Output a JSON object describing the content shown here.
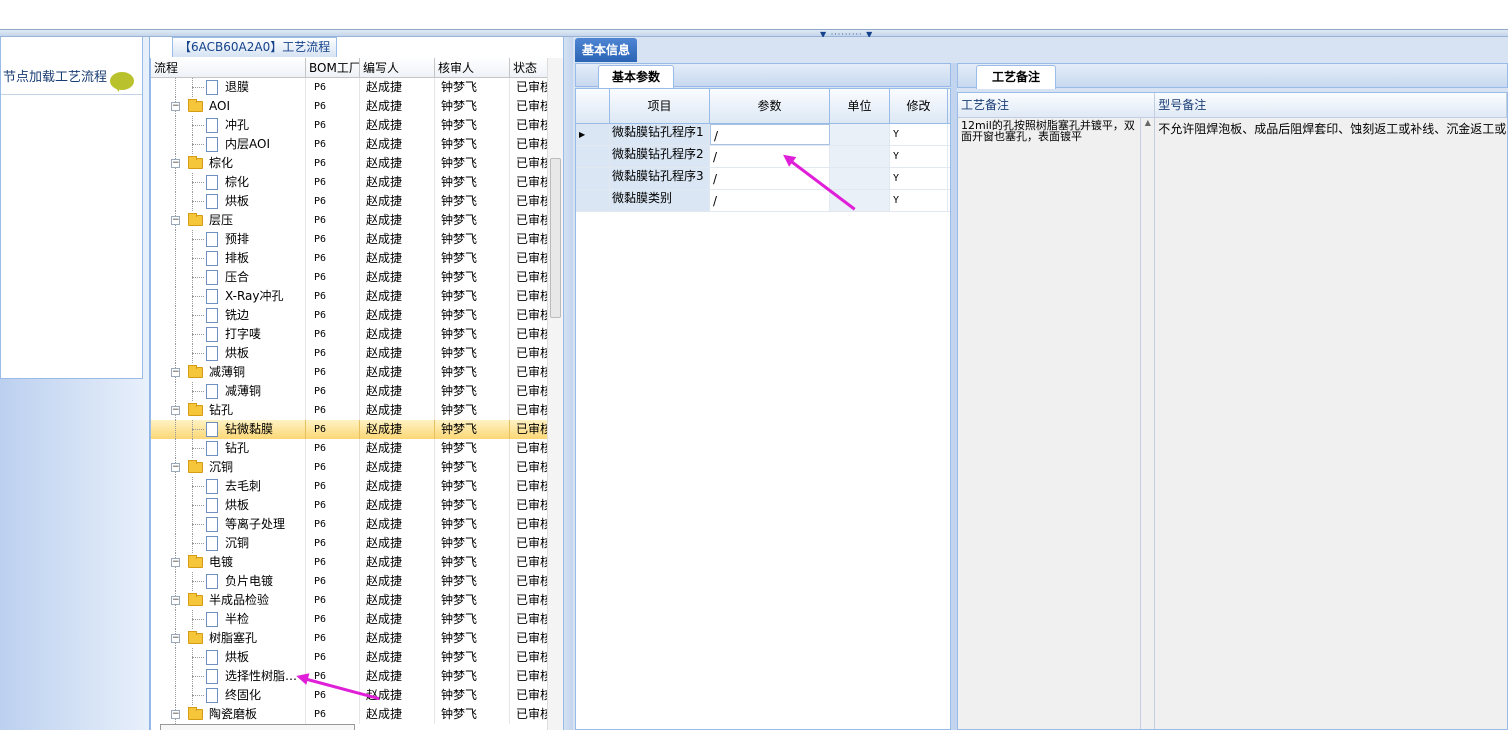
{
  "left_panel": {
    "header": "节点加载工艺流程",
    "bubble_icon": "speech-bubble-icon"
  },
  "tree_tab": {
    "title": "【6ACB60A2A0】工艺流程"
  },
  "tree": {
    "columns": [
      "流程",
      "BOM工厂",
      "编写人",
      "核审人",
      "状态"
    ],
    "rows": [
      {
        "name": "退膜",
        "type": "leaf",
        "bom": "P6",
        "writer": "赵成捷",
        "reviewer": "钟梦飞",
        "status": "已审核"
      },
      {
        "name": "AOI",
        "type": "folder",
        "bom": "P6",
        "writer": "赵成捷",
        "reviewer": "钟梦飞",
        "status": "已审核"
      },
      {
        "name": "冲孔",
        "type": "leaf",
        "bom": "P6",
        "writer": "赵成捷",
        "reviewer": "钟梦飞",
        "status": "已审核"
      },
      {
        "name": "内层AOI",
        "type": "leaf",
        "bom": "P6",
        "writer": "赵成捷",
        "reviewer": "钟梦飞",
        "status": "已审核"
      },
      {
        "name": "棕化",
        "type": "folder",
        "bom": "P6",
        "writer": "赵成捷",
        "reviewer": "钟梦飞",
        "status": "已审核"
      },
      {
        "name": "棕化",
        "type": "leaf",
        "bom": "P6",
        "writer": "赵成捷",
        "reviewer": "钟梦飞",
        "status": "已审核"
      },
      {
        "name": "烘板",
        "type": "leaf",
        "bom": "P6",
        "writer": "赵成捷",
        "reviewer": "钟梦飞",
        "status": "已审核"
      },
      {
        "name": "层压",
        "type": "folder",
        "bom": "P6",
        "writer": "赵成捷",
        "reviewer": "钟梦飞",
        "status": "已审核"
      },
      {
        "name": "预排",
        "type": "leaf",
        "bom": "P6",
        "writer": "赵成捷",
        "reviewer": "钟梦飞",
        "status": "已审核"
      },
      {
        "name": "排板",
        "type": "leaf",
        "bom": "P6",
        "writer": "赵成捷",
        "reviewer": "钟梦飞",
        "status": "已审核"
      },
      {
        "name": "压合",
        "type": "leaf",
        "bom": "P6",
        "writer": "赵成捷",
        "reviewer": "钟梦飞",
        "status": "已审核"
      },
      {
        "name": "X-Ray冲孔",
        "type": "leaf",
        "bom": "P6",
        "writer": "赵成捷",
        "reviewer": "钟梦飞",
        "status": "已审核"
      },
      {
        "name": "铣边",
        "type": "leaf",
        "bom": "P6",
        "writer": "赵成捷",
        "reviewer": "钟梦飞",
        "status": "已审核"
      },
      {
        "name": "打字唛",
        "type": "leaf",
        "bom": "P6",
        "writer": "赵成捷",
        "reviewer": "钟梦飞",
        "status": "已审核"
      },
      {
        "name": "烘板",
        "type": "leaf",
        "bom": "P6",
        "writer": "赵成捷",
        "reviewer": "钟梦飞",
        "status": "已审核"
      },
      {
        "name": "减薄铜",
        "type": "folder",
        "bom": "P6",
        "writer": "赵成捷",
        "reviewer": "钟梦飞",
        "status": "已审核"
      },
      {
        "name": "减薄铜",
        "type": "leaf",
        "bom": "P6",
        "writer": "赵成捷",
        "reviewer": "钟梦飞",
        "status": "已审核"
      },
      {
        "name": "钻孔",
        "type": "folder",
        "bom": "P6",
        "writer": "赵成捷",
        "reviewer": "钟梦飞",
        "status": "已审核"
      },
      {
        "name": "钻微黏膜",
        "type": "leaf",
        "bom": "P6",
        "writer": "赵成捷",
        "reviewer": "钟梦飞",
        "status": "已审核",
        "selected": true
      },
      {
        "name": "钻孔",
        "type": "leaf",
        "bom": "P6",
        "writer": "赵成捷",
        "reviewer": "钟梦飞",
        "status": "已审核"
      },
      {
        "name": "沉铜",
        "type": "folder",
        "bom": "P6",
        "writer": "赵成捷",
        "reviewer": "钟梦飞",
        "status": "已审核"
      },
      {
        "name": "去毛刺",
        "type": "leaf",
        "bom": "P6",
        "writer": "赵成捷",
        "reviewer": "钟梦飞",
        "status": "已审核"
      },
      {
        "name": "烘板",
        "type": "leaf",
        "bom": "P6",
        "writer": "赵成捷",
        "reviewer": "钟梦飞",
        "status": "已审核"
      },
      {
        "name": "等离子处理",
        "type": "leaf",
        "bom": "P6",
        "writer": "赵成捷",
        "reviewer": "钟梦飞",
        "status": "已审核"
      },
      {
        "name": "沉铜",
        "type": "leaf",
        "bom": "P6",
        "writer": "赵成捷",
        "reviewer": "钟梦飞",
        "status": "已审核"
      },
      {
        "name": "电镀",
        "type": "folder",
        "bom": "P6",
        "writer": "赵成捷",
        "reviewer": "钟梦飞",
        "status": "已审核"
      },
      {
        "name": "负片电镀",
        "type": "leaf",
        "bom": "P6",
        "writer": "赵成捷",
        "reviewer": "钟梦飞",
        "status": "已审核"
      },
      {
        "name": "半成品检验",
        "type": "folder",
        "bom": "P6",
        "writer": "赵成捷",
        "reviewer": "钟梦飞",
        "status": "已审核"
      },
      {
        "name": "半检",
        "type": "leaf",
        "bom": "P6",
        "writer": "赵成捷",
        "reviewer": "钟梦飞",
        "status": "已审核"
      },
      {
        "name": "树脂塞孔",
        "type": "folder",
        "bom": "P6",
        "writer": "赵成捷",
        "reviewer": "钟梦飞",
        "status": "已审核"
      },
      {
        "name": "烘板",
        "type": "leaf",
        "bom": "P6",
        "writer": "赵成捷",
        "reviewer": "钟梦飞",
        "status": "已审核"
      },
      {
        "name": "选择性树脂…",
        "type": "leaf",
        "bom": "P6",
        "writer": "赵成捷",
        "reviewer": "钟梦飞",
        "status": "已审核"
      },
      {
        "name": "终固化",
        "type": "leaf",
        "bom": "P6",
        "writer": "赵成捷",
        "reviewer": "钟梦飞",
        "status": "已审核"
      },
      {
        "name": "陶瓷磨板",
        "type": "folder",
        "bom": "P6",
        "writer": "赵成捷",
        "reviewer": "钟梦飞",
        "status": "已审核"
      }
    ]
  },
  "main_tab": {
    "label": "基本信息"
  },
  "params_tab": {
    "label": "基本参数"
  },
  "params_grid": {
    "columns": [
      "项目",
      "参数",
      "单位",
      "修改"
    ],
    "rows": [
      {
        "item": "微黏膜钻孔程序1",
        "value": "/",
        "unit": "",
        "modify": "Y",
        "current": true
      },
      {
        "item": "微黏膜钻孔程序2",
        "value": "/",
        "unit": "",
        "modify": "Y"
      },
      {
        "item": "微黏膜钻孔程序3",
        "value": "/",
        "unit": "",
        "modify": "Y"
      },
      {
        "item": "微黏膜类别",
        "value": "/",
        "unit": "",
        "modify": "Y"
      }
    ]
  },
  "notes_tab": {
    "label": "工艺备注"
  },
  "notes": {
    "headers": [
      "工艺备注",
      "型号备注"
    ],
    "process_note": "12mil的孔按照树脂塞孔并镀平，双面开窗也塞孔，表面镀平",
    "model_note": "不允许阻焊泡板、成品后阻焊套印、蚀刻返工或补线、沉金返工或"
  },
  "colors": {
    "accent": "#2c64b5",
    "arrow": "#e020d8",
    "selected": "#fbd776"
  }
}
